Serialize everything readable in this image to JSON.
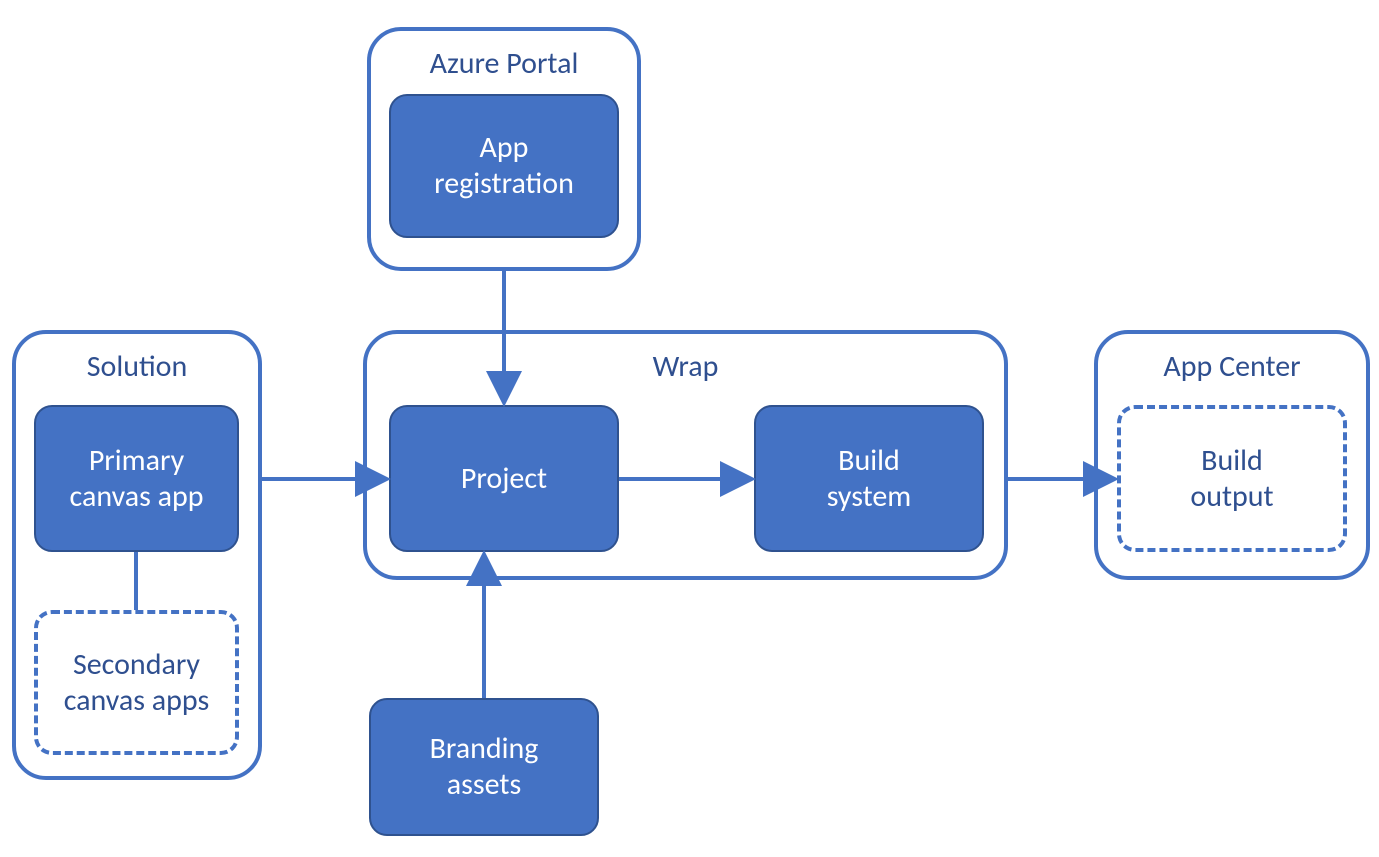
{
  "colors": {
    "primary_blue": "#4472C4",
    "dark_blue": "#2F528F",
    "text_blue": "#2F4F8F",
    "white": "#FFFFFF"
  },
  "containers": {
    "azure_portal": {
      "title": "Azure Portal"
    },
    "solution": {
      "title": "Solution"
    },
    "wrap": {
      "title": "Wrap"
    },
    "app_center": {
      "title": "App Center"
    }
  },
  "nodes": {
    "app_registration": {
      "label": "App\nregistration",
      "style": "solid"
    },
    "primary_canvas_app": {
      "label": "Primary\ncanvas app",
      "style": "solid"
    },
    "secondary_canvas_apps": {
      "label": "Secondary\ncanvas apps",
      "style": "dashed"
    },
    "project": {
      "label": "Project",
      "style": "solid"
    },
    "build_system": {
      "label": "Build\nsystem",
      "style": "solid"
    },
    "branding_assets": {
      "label": "Branding\nassets",
      "style": "solid"
    },
    "build_output": {
      "label": "Build\noutput",
      "style": "dashed"
    }
  },
  "edges": [
    {
      "from": "app_registration",
      "to": "project",
      "direction": "down"
    },
    {
      "from": "primary_canvas_app",
      "to": "project",
      "direction": "right"
    },
    {
      "from": "primary_canvas_app",
      "to": "secondary_canvas_apps",
      "direction": "down",
      "arrowhead": false
    },
    {
      "from": "project",
      "to": "build_system",
      "direction": "right"
    },
    {
      "from": "build_system",
      "to": "build_output",
      "direction": "right"
    },
    {
      "from": "branding_assets",
      "to": "project",
      "direction": "up"
    }
  ]
}
